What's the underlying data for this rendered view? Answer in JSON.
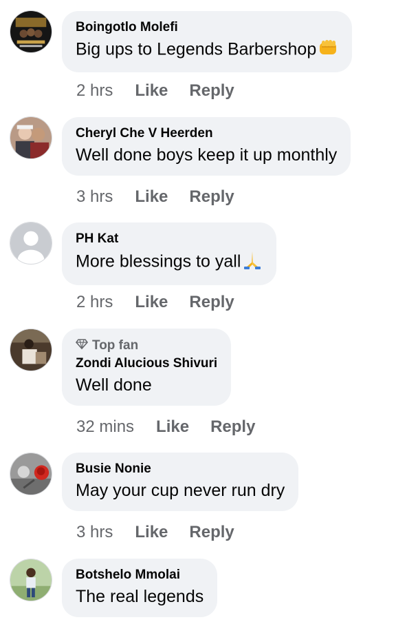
{
  "comments": [
    {
      "author": "Boingotlo Molefi",
      "text": "Big ups to Legends Barbershop",
      "emoji": "fist-icon",
      "time": "2 hrs",
      "like": "Like",
      "reply": "Reply"
    },
    {
      "author": "Cheryl Che V Heerden",
      "text": "Well done boys keep it up monthly",
      "time": "3 hrs",
      "like": "Like",
      "reply": "Reply"
    },
    {
      "author": "PH Kat",
      "text": "More blessings to yall",
      "emoji": "praying-hands-icon",
      "time": "2 hrs",
      "like": "Like",
      "reply": "Reply"
    },
    {
      "badge": "Top fan",
      "author": "Zondi Alucious Shivuri",
      "text": "Well done",
      "time": "32 mins",
      "like": "Like",
      "reply": "Reply"
    },
    {
      "author": "Busie Nonie",
      "text": "May your cup never run dry",
      "time": "3 hrs",
      "like": "Like",
      "reply": "Reply"
    },
    {
      "author": "Botshelo Mmolai",
      "text": "The real legends"
    }
  ],
  "colors": {
    "bubble": "#f0f2f5",
    "meta": "#65676b",
    "text": "#050505"
  }
}
